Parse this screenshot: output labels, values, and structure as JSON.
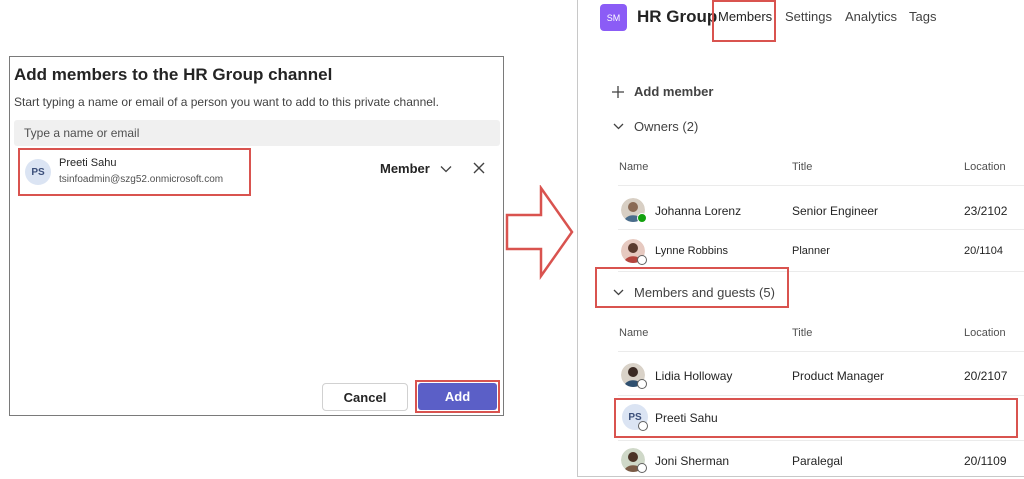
{
  "dialog": {
    "title": "Add members to the HR Group channel",
    "subtitle": "Start typing a name or email of a person you want to add to this private channel.",
    "input_placeholder": "Type a name or email",
    "selected_person": {
      "initials": "PS",
      "name": "Preeti Sahu",
      "email": "tsinfoadmin@szg52.onmicrosoft.com"
    },
    "role": "Member",
    "cancel_label": "Cancel",
    "add_label": "Add"
  },
  "team": {
    "badge": "SM",
    "name": "HR Group",
    "tabs": [
      "Members",
      "Settings",
      "Analytics",
      "Tags"
    ]
  },
  "members_page": {
    "add_member_label": "Add member",
    "owners_label": "Owners (2)",
    "members_label": "Members and guests (5)",
    "columns": [
      "Name",
      "Title",
      "Location"
    ],
    "owners": [
      {
        "name": "Johanna Lorenz",
        "title": "Senior Engineer",
        "location": "23/2102",
        "status": "available"
      },
      {
        "name": "Lynne Robbins",
        "title": "Planner",
        "location": "20/1104",
        "status": "offline"
      }
    ],
    "members": [
      {
        "name": "Lidia Holloway",
        "title": "Product Manager",
        "location": "20/2107",
        "status": "offline"
      },
      {
        "name": "Preeti Sahu",
        "title": "",
        "location": "",
        "initials": "PS",
        "status": "offline"
      },
      {
        "name": "Joni Sherman",
        "title": "Paralegal",
        "location": "20/1109",
        "status": "offline"
      }
    ]
  },
  "colors": {
    "accent": "#5b5fc7",
    "highlight": "#d9534f",
    "team_badge": "#8b5cf6"
  }
}
